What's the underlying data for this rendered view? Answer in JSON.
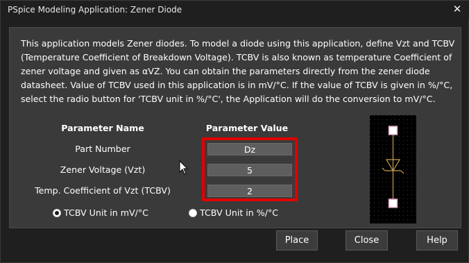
{
  "window": {
    "title": "PSpice Modeling Application: Zener Diode",
    "close_glyph": "✕"
  },
  "description": "This application models Zener diodes. To model a diode using this application, define Vzt and TCBV (Temperature Coefficient of Breakdown Voltage). TCBV is also known as temperature Coefficient of zener voltage and given as αVZ. You can obtain the parameters directly from the zener diode datasheet. Value of TCBV used in this application is in mV/°C. If the value of TCBV is given in %/°C, select the radio button for 'TCBV unit in %/°C', the Application will do the conversion to mV/°C.",
  "table": {
    "header_name": "Parameter Name",
    "header_value": "Parameter Value",
    "rows": [
      {
        "label": "Part Number",
        "value": "Dz"
      },
      {
        "label": "Zener Voltage (Vzt)",
        "value": "5"
      },
      {
        "label": "Temp. Coefficient of Vzt (TCBV)",
        "value": "2"
      }
    ]
  },
  "radios": {
    "mv": {
      "label": "TCBV Unit in mV/°C",
      "checked": true
    },
    "pct": {
      "label": "TCBV Unit in %/°C",
      "checked": false
    }
  },
  "symbol": {
    "icon": "zener-diode-symbol-icon"
  },
  "buttons": {
    "place": "Place",
    "close": "Close",
    "help": "Help"
  },
  "colors": {
    "highlight": "#e00000",
    "symbol_line": "#c8a050",
    "pin_box": "#ffffff"
  }
}
